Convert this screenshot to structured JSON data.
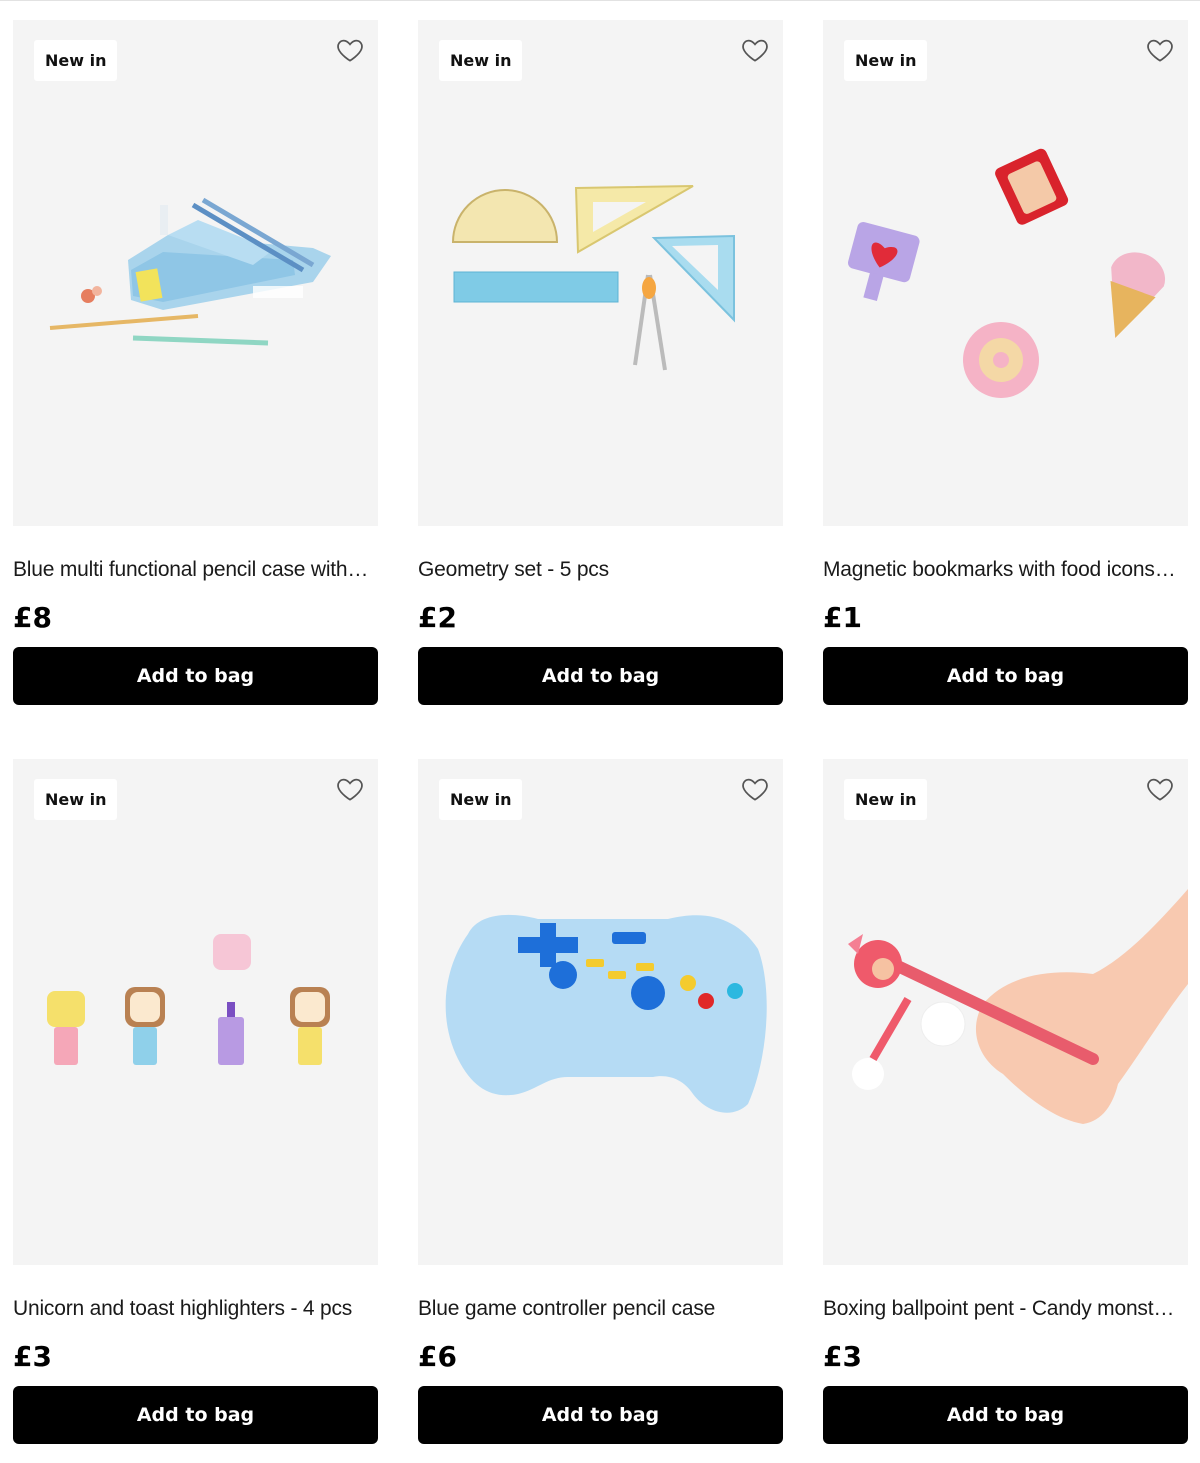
{
  "products": [
    {
      "badge": "New in",
      "title": "Blue multi functional pencil case with…",
      "price": "£8",
      "button": "Add to bag",
      "art": "pencil-case"
    },
    {
      "badge": "New in",
      "title": "Geometry set - 5 pcs",
      "price": "£2",
      "button": "Add to bag",
      "art": "geometry-set"
    },
    {
      "badge": "New in",
      "title": "Magnetic bookmarks with food icons…",
      "price": "£1",
      "button": "Add to bag",
      "art": "bookmarks"
    },
    {
      "badge": "New in",
      "title": "Unicorn and toast highlighters - 4 pcs",
      "price": "£3",
      "button": "Add to bag",
      "art": "highlighters"
    },
    {
      "badge": "New in",
      "title": "Blue game controller pencil case",
      "price": "£6",
      "button": "Add to bag",
      "art": "game-controller"
    },
    {
      "badge": "New in",
      "title": "Boxing ballpoint pent - Candy monst…",
      "price": "£3",
      "button": "Add to bag",
      "art": "boxing-pen"
    }
  ],
  "icons": {
    "favourite": "heart-outline-icon"
  },
  "colors": {
    "button_bg": "#000000",
    "button_text": "#ffffff",
    "image_bg": "#f4f4f4"
  }
}
